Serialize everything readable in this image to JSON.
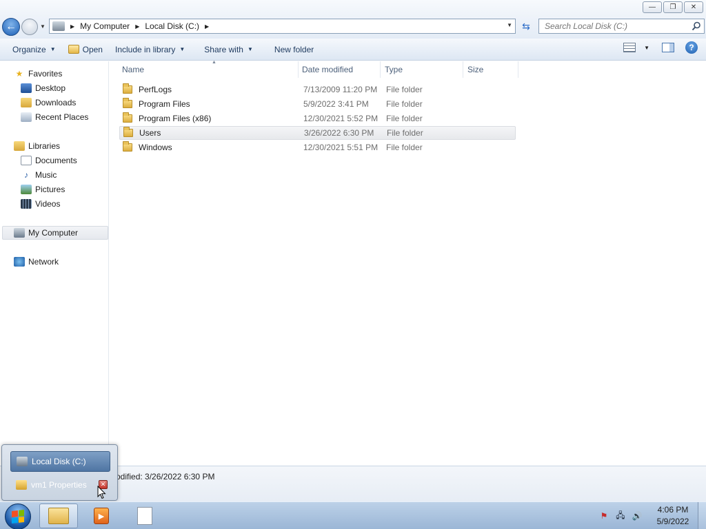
{
  "window": {
    "minimize": "—",
    "maximize": "❐",
    "close": "✕"
  },
  "address": {
    "crumbs": [
      "My Computer",
      "Local Disk (C:)"
    ],
    "search_placeholder": "Search Local Disk (C:)"
  },
  "toolbar": {
    "organize": "Organize",
    "open": "Open",
    "include_in_library": "Include in library",
    "share_with": "Share with",
    "new_folder": "New folder"
  },
  "nav": {
    "favorites": "Favorites",
    "desktop": "Desktop",
    "downloads": "Downloads",
    "recent_places": "Recent Places",
    "libraries": "Libraries",
    "documents": "Documents",
    "music": "Music",
    "pictures": "Pictures",
    "videos": "Videos",
    "my_computer": "My Computer",
    "network": "Network"
  },
  "columns": {
    "name": "Name",
    "date_modified": "Date modified",
    "type": "Type",
    "size": "Size"
  },
  "files": [
    {
      "name": "PerfLogs",
      "date": "7/13/2009 11:20 PM",
      "type": "File folder"
    },
    {
      "name": "Program Files",
      "date": "5/9/2022 3:41 PM",
      "type": "File folder"
    },
    {
      "name": "Program Files (x86)",
      "date": "12/30/2021 5:52 PM",
      "type": "File folder"
    },
    {
      "name": "Users",
      "date": "3/26/2022 6:30 PM",
      "type": "File folder"
    },
    {
      "name": "Windows",
      "date": "12/30/2021 5:51 PM",
      "type": "File folder"
    }
  ],
  "details": {
    "text": "odified: 3/26/2022 6:30 PM"
  },
  "popup": {
    "item1": "Local Disk (C:)",
    "item2": "vm1 Properties"
  },
  "clock": {
    "time": "4:06 PM",
    "date": "5/9/2022"
  },
  "colors": {
    "accent": "#1c5fb5",
    "taskbar": "#9bb6d6"
  }
}
